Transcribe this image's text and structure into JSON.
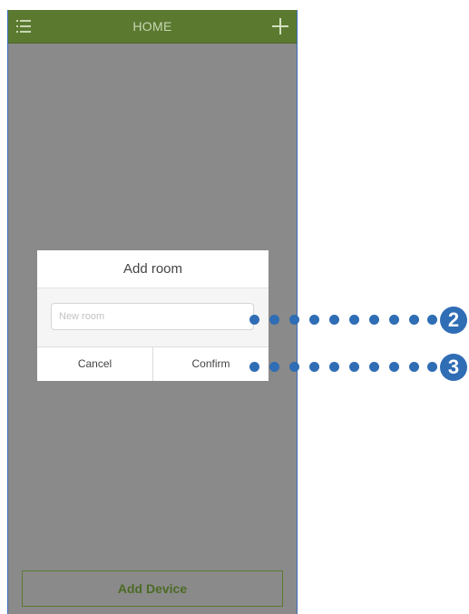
{
  "header": {
    "title": "HOME",
    "menu_icon": "menu-icon",
    "add_icon": "plus-icon",
    "bar_color": "#5b7a30"
  },
  "dialog": {
    "title": "Add room",
    "input": {
      "value": "",
      "placeholder": "New room"
    },
    "cancel_label": "Cancel",
    "confirm_label": "Confirm"
  },
  "footer": {
    "add_device_label": "Add Device",
    "accent_color": "#4c6b24"
  },
  "callouts": [
    {
      "number": "2",
      "target": "room-name-input"
    },
    {
      "number": "3",
      "target": "confirm-button"
    }
  ],
  "callout_color": "#2f6db5"
}
